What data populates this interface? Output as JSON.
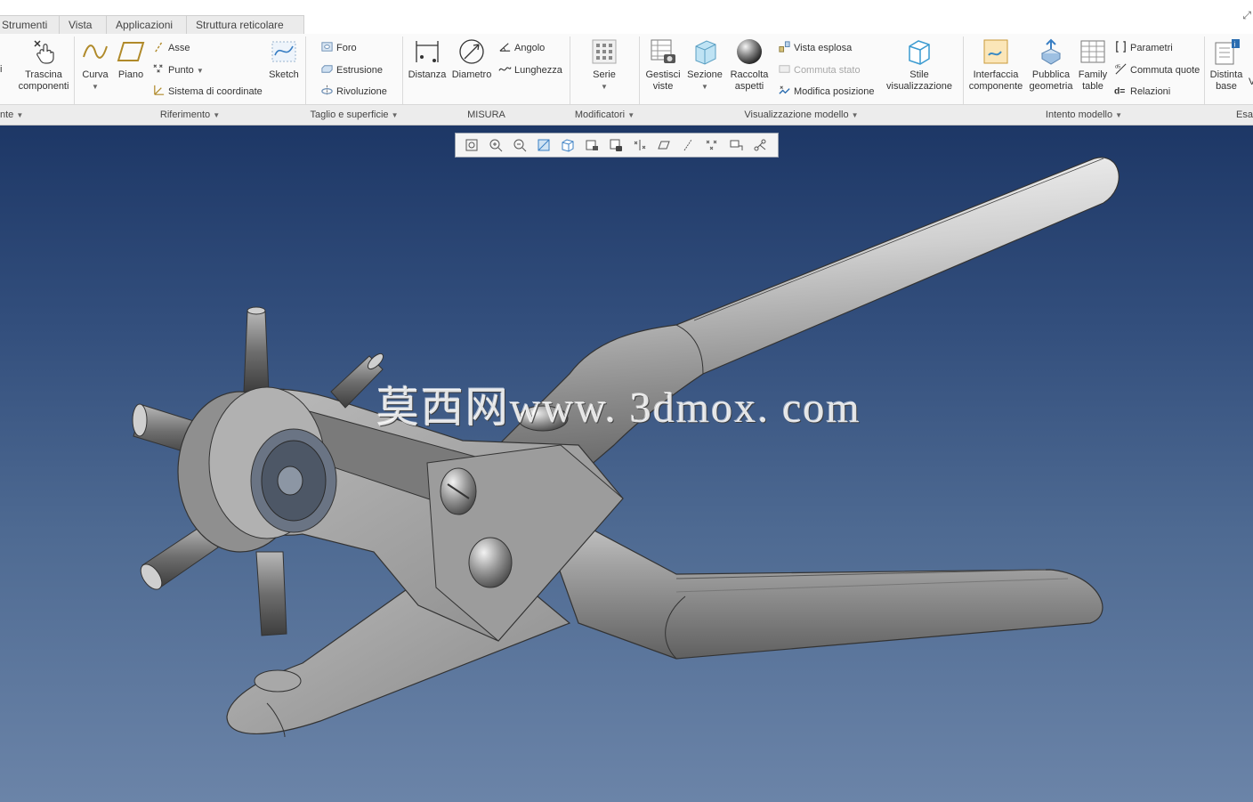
{
  "tabs": [
    {
      "label": "Strumenti"
    },
    {
      "label": "Vista"
    },
    {
      "label": "Applicazioni"
    },
    {
      "label": "Struttura reticolare"
    }
  ],
  "ribbon": {
    "cut_left_label": "i",
    "trascina": "Trascina componenti",
    "curva": "Curva",
    "piano": "Piano",
    "asse": "Asse",
    "punto": "Punto",
    "sistema_coordinate": "Sistema di coordinate",
    "sketch": "Sketch",
    "foro": "Foro",
    "estrusione": "Estrusione",
    "rivoluzione": "Rivoluzione",
    "distanza": "Distanza",
    "diametro": "Diametro",
    "angolo": "Angolo",
    "lunghezza": "Lunghezza",
    "serie": "Serie",
    "gestisci_viste": "Gestisci viste",
    "sezione": "Sezione",
    "raccolta_aspetti": "Raccolta aspetti",
    "vista_esplosa": "Vista esplosa",
    "commuta_stato": "Commuta stato",
    "modifica_posizione": "Modifica posizione",
    "stile_visualizzazione": "Stile visualizzazione",
    "interfaccia_componente": "Interfaccia componente",
    "pubblica_geometria": "Pubblica geometria",
    "family_table": "Family table",
    "parametri": "Parametri",
    "commuta_quote": "Commuta quote",
    "relazioni": "Relazioni",
    "distinta_base": "Distinta base",
    "cut_right_label": "V"
  },
  "groups": {
    "g0": "nte",
    "g1": "Riferimento",
    "g2": "Taglio e superficie",
    "g3": "MISURA",
    "g4": "Modificatori",
    "g5": "Visualizzazione modello",
    "g6": "Intento modello",
    "g7": "Esa"
  },
  "view_toolbar_icons": [
    "refit-icon",
    "zoom-in-icon",
    "zoom-out-icon",
    "repaint-icon",
    "display-style-icon",
    "saved-views-icon",
    "named-view-icon",
    "plane-display-icon",
    "axis-display-icon",
    "point-display-icon",
    "csys-display-icon",
    "annotation-display-icon",
    "spin-center-icon"
  ],
  "watermark": "莫西网www. 3dmox. com",
  "colors": {
    "bg_top": "#1d3766",
    "bg_bottom": "#6b84a8",
    "model_metal": "#a9a9a9"
  }
}
